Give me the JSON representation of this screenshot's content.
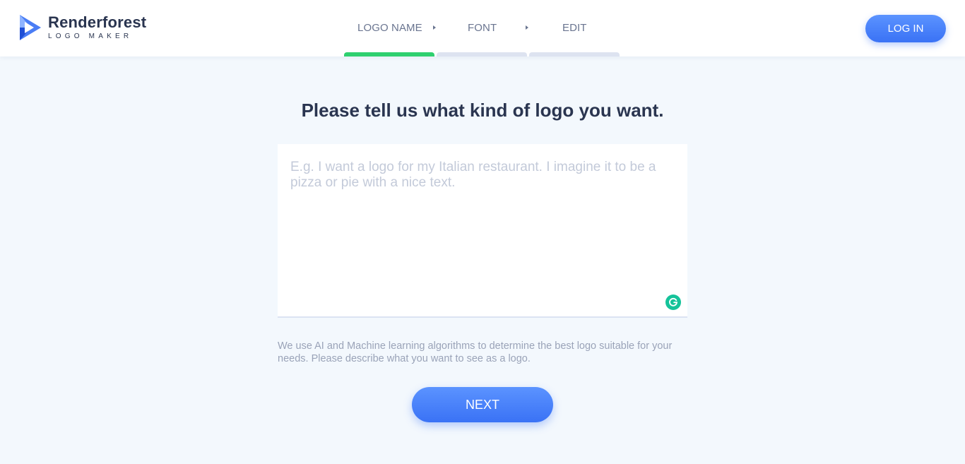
{
  "brand": {
    "name": "Renderforest",
    "subtitle": "LOGO MAKER",
    "colors": {
      "light": "#8fb4ff",
      "mid": "#4a7df5",
      "dark": "#1f4fd6"
    }
  },
  "steps": [
    {
      "label": "LOGO NAME",
      "state": "active"
    },
    {
      "label": "FONT",
      "state": "inactive"
    },
    {
      "label": "EDIT",
      "state": "inactive"
    }
  ],
  "colors": {
    "progress_active": "#2fd06f",
    "progress_inactive": "#dde3f0",
    "accent": "#3a72f5",
    "grammarly": "#15c39a"
  },
  "header": {
    "login_label": "LOG IN"
  },
  "main": {
    "title": "Please tell us what kind of logo you want.",
    "textarea_placeholder": "E.g. I want a logo for my Italian restaurant. I imagine it to be a pizza or pie with a nice text.",
    "textarea_value": "",
    "helper_text": "We use AI and Machine learning algorithms to determine the best logo suitable for your needs. Please describe what you want to see as a logo.",
    "next_label": "NEXT",
    "grammarly_icon": "grammarly-icon"
  }
}
